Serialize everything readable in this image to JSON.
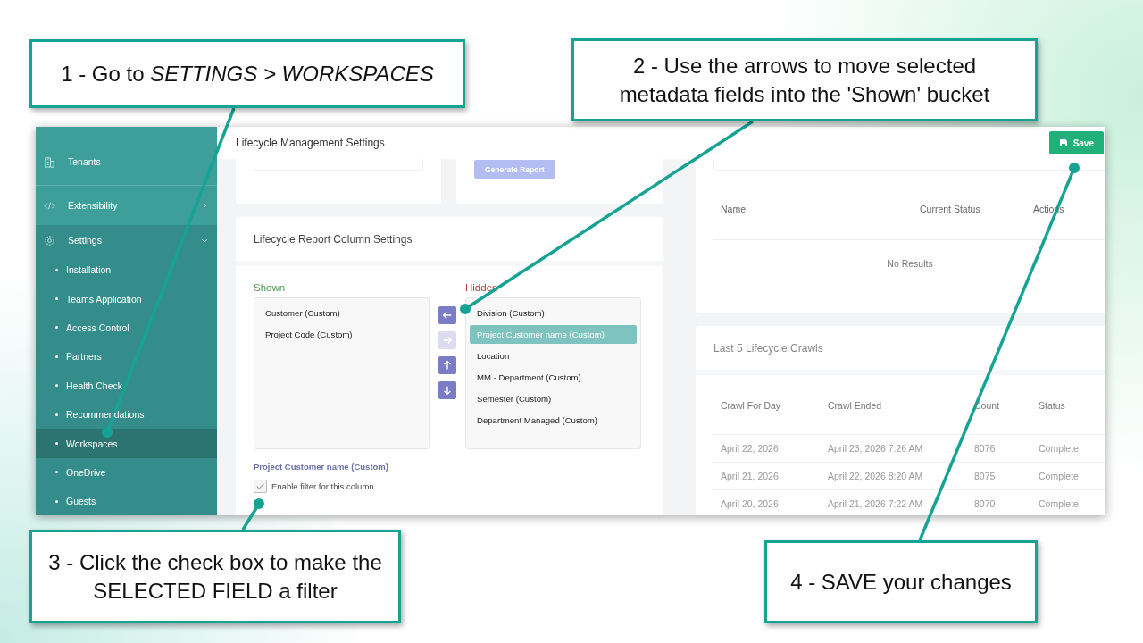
{
  "callouts": [
    {
      "text": "1 - Go to *SETTINGS > WORKSPACES*"
    },
    {
      "text": "2 - Use the arrows to move selected metadata fields into the 'Shown' bucket"
    },
    {
      "text": "3 - Click the check box to make the SELECTED FIELD a filter"
    },
    {
      "text": "4 - SAVE your changes"
    }
  ],
  "sidebar": {
    "sections": [
      {
        "label": "Tenants"
      },
      {
        "label": "Extensibility",
        "expanded": false
      },
      {
        "label": "Settings",
        "expanded": true,
        "children": [
          {
            "label": "Installation",
            "selected": false
          },
          {
            "label": "Teams Application",
            "selected": false
          },
          {
            "label": "Access Control",
            "selected": false
          },
          {
            "label": "Partners",
            "selected": false
          },
          {
            "label": "Health Check",
            "selected": false
          },
          {
            "label": "Recommendations",
            "selected": false
          },
          {
            "label": "Workspaces",
            "selected": true
          },
          {
            "label": "OneDrive",
            "selected": false
          },
          {
            "label": "Guests",
            "selected": false
          }
        ]
      }
    ]
  },
  "header": {
    "title": "Lifecycle Management Settings",
    "save_button": "Save"
  },
  "report_card": {
    "generate_button": {
      "label": "Generate Report",
      "disabled": true
    }
  },
  "column_settings": {
    "title": "Lifecycle Report Column Settings",
    "shown_label": "Shown",
    "hidden_label": "Hidden",
    "shown": [
      {
        "label": "Customer (Custom)",
        "selected": false
      },
      {
        "label": "Project Code (Custom)",
        "selected": false
      }
    ],
    "hidden": [
      {
        "label": "Division (Custom)",
        "selected": false
      },
      {
        "label": "Project Customer name (Custom)",
        "selected": true
      },
      {
        "label": "Location",
        "selected": false
      },
      {
        "label": "MM - Department (Custom)",
        "selected": false
      },
      {
        "label": "Semester (Custom)",
        "selected": false
      },
      {
        "label": "Department Managed (Custom)",
        "selected": false
      }
    ],
    "arrow_buttons": [
      {
        "kind": "left",
        "disabled": false
      },
      {
        "kind": "right",
        "disabled": true
      },
      {
        "kind": "up",
        "disabled": false
      },
      {
        "kind": "down",
        "disabled": false
      }
    ],
    "selected_field": "Project Customer name (Custom)",
    "filter_checkbox": {
      "label": "Enable filter for this column",
      "checked": true
    }
  },
  "workspaces_table": {
    "columns": [
      "Name",
      "Current Status",
      "Actions"
    ],
    "empty_text": "No Results"
  },
  "crawls": {
    "title": "Last 5 Lifecycle Crawls",
    "columns": [
      "Crawl For Day",
      "Crawl Ended",
      "Count",
      "Status"
    ],
    "rows": [
      [
        "April 22, 2026",
        "April 23, 2026 7:26 AM",
        "8076",
        "Complete"
      ],
      [
        "April 21, 2026",
        "April 22, 2026 8:20 AM",
        "8075",
        "Complete"
      ],
      [
        "April 20, 2026",
        "April 21, 2026 7:22 AM",
        "8070",
        "Complete"
      ]
    ]
  }
}
